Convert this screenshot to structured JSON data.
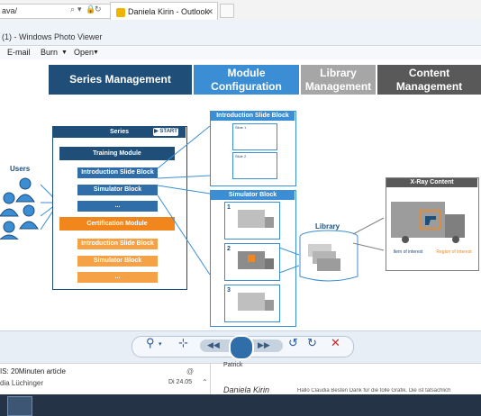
{
  "browser": {
    "address": "ava/",
    "tab_title": "Daniela Kirin - Outlook We..."
  },
  "window": {
    "title": "(1) - Windows Photo Viewer"
  },
  "menu": {
    "items": [
      "E-mail",
      "Burn",
      "Open"
    ]
  },
  "diagram": {
    "headers": [
      "Series Management",
      "Module Configuration",
      "Library Management",
      "Content Management"
    ],
    "header_colors": [
      "#1f4e79",
      "#3b8ed4",
      "#a6a6a6",
      "#595959"
    ],
    "users_label": "Users",
    "series": {
      "title": "Series",
      "start_label": "START",
      "training": "Training Module",
      "intro": "Introduction Slide Block",
      "sim": "Simulator Block",
      "dots": "...",
      "certification": "Certification Module",
      "intro2": "Introduction Slide Block",
      "sim2": "Simulator Block",
      "dots2": "..."
    },
    "intro_block": {
      "title": "Introduction Slide Block",
      "slide1": "Slide 1",
      "slide2": "Slide 2"
    },
    "sim_block": {
      "title": "Simulator Block",
      "n1": "1",
      "n2": "2",
      "n3": "3"
    },
    "library_label": "Library",
    "xray": {
      "title": "X-Ray Content",
      "item_label": "Item of interest",
      "region_label": "Region of interest"
    }
  },
  "mail": {
    "row1_subject": "IS: 20Minuten article",
    "row1_from": "dia Lüchinger",
    "row1_date": "Di 24.05",
    "row2_name": "Patrick",
    "row2_sender": "Daniela Kirin",
    "row2_preview": "Hallo Claudia Besten Dank für die tolle Grafik. Die ist tatsächlich"
  }
}
